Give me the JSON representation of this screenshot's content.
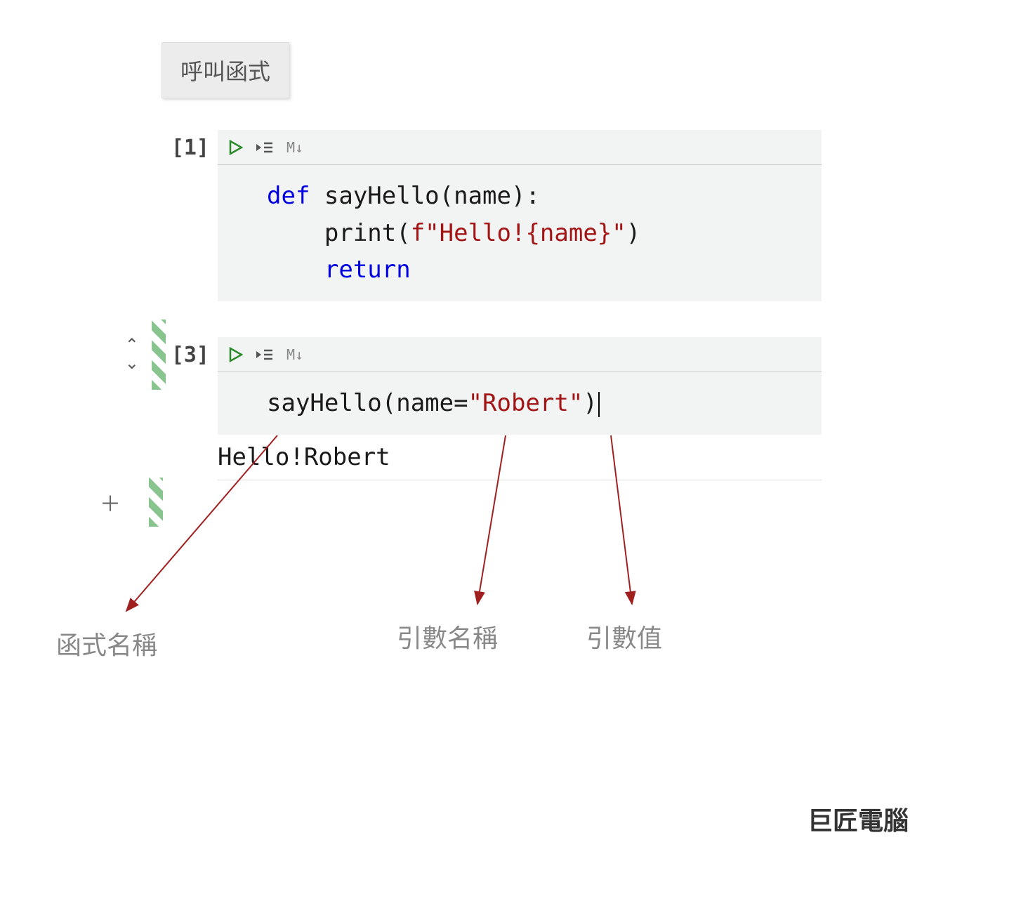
{
  "title": "呼叫函式",
  "cell1": {
    "prompt": "[1]",
    "toolbar": {
      "md": "M↓"
    },
    "code": {
      "line1_kw": "def",
      "line1_rest": " sayHello(name):",
      "line2_pre": "    print(",
      "line2_f": "f\"Hello!{name}\"",
      "line2_post": ")",
      "line3_indent": "    ",
      "line3_kw": "return"
    }
  },
  "cell2": {
    "prompt": "[3]",
    "toolbar": {
      "md": "M↓"
    },
    "code": {
      "call_pre": "sayHello(name=",
      "call_str": "\"Robert\"",
      "call_post": ")"
    },
    "output": "Hello!Robert"
  },
  "annotations": {
    "function_name": "函式名稱",
    "arg_name": "引數名稱",
    "arg_value": "引數值"
  },
  "watermark": "巨匠電腦",
  "icons": {
    "add": "＋"
  }
}
